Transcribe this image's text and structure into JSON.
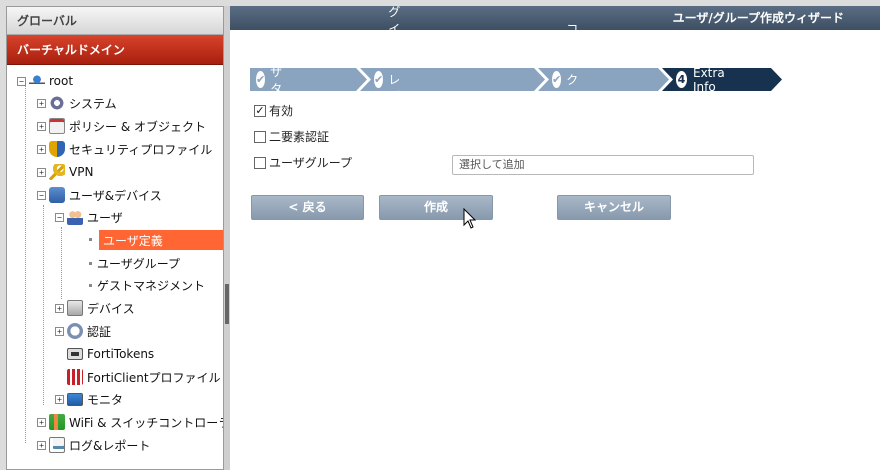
{
  "sidebar": {
    "global_label": "グローバル",
    "vdom_label": "バーチャルドメイン",
    "tree": {
      "root": "root",
      "system": "システム",
      "policy": "ポリシー & オブジェクト",
      "security": "セキュリティプロファイル",
      "vpn": "VPN",
      "user_device": "ユーザ&デバイス",
      "user": "ユーザ",
      "user_def": "ユーザ定義",
      "user_group": "ユーザグループ",
      "guest": "ゲストマネジメント",
      "device": "デバイス",
      "auth": "認証",
      "fortitokens": "FortiTokens",
      "forticlient": "FortiClientプロファイル",
      "monitor": "モニタ",
      "wifi": "WiFi & スイッチコントローラー",
      "log": "ログ&レポート"
    }
  },
  "wizard": {
    "title": "ユーザ/グループ作成ウィザード",
    "steps": [
      {
        "label": "ユーザタイプ",
        "state": "done"
      },
      {
        "label": "ログイン クレデンシャル",
        "state": "done"
      },
      {
        "label": "コンタクト情報",
        "state": "done"
      },
      {
        "label": "Extra Info",
        "state": "current",
        "number": "4"
      }
    ],
    "options": {
      "enabled": {
        "label": "有効",
        "checked": true
      },
      "two_factor": {
        "label": "二要素認証",
        "checked": false
      },
      "user_group": {
        "label": "ユーザグループ",
        "checked": false
      }
    },
    "group_placeholder": "選択して追加",
    "buttons": {
      "back": "< 戻る",
      "create": "作成",
      "cancel": "キャンセル"
    }
  },
  "colors": {
    "vdom_header": "#b82a16",
    "selection": "#ff6633",
    "step_done": "#8aa4c0",
    "step_current": "#17324f",
    "titlebar": "#4a5c72"
  }
}
